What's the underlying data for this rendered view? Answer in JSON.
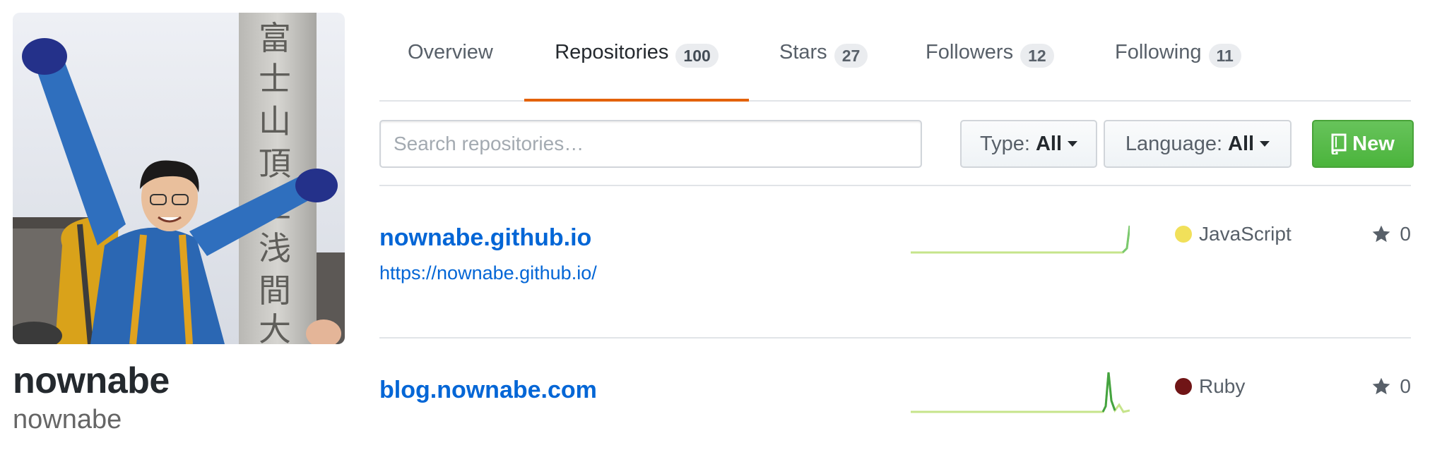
{
  "profile": {
    "fullname": "nownabe",
    "username": "nownabe"
  },
  "tabs": [
    {
      "label": "Overview",
      "count": null,
      "selected": false
    },
    {
      "label": "Repositories",
      "count": "100",
      "selected": true
    },
    {
      "label": "Stars",
      "count": "27",
      "selected": false
    },
    {
      "label": "Followers",
      "count": "12",
      "selected": false
    },
    {
      "label": "Following",
      "count": "11",
      "selected": false
    }
  ],
  "filters": {
    "search_placeholder": "Search repositories…",
    "type_label": "Type:",
    "type_value": "All",
    "language_label": "Language:",
    "language_value": "All",
    "new_label": "New"
  },
  "repos": [
    {
      "name": "nownabe.github.io",
      "description": "https://nownabe.github.io/",
      "language": "JavaScript",
      "language_color": "#f1e05a",
      "stars": "0"
    },
    {
      "name": "blog.nownabe.com",
      "description": "",
      "language": "Ruby",
      "language_color": "#701516",
      "stars": "0"
    }
  ],
  "colors": {
    "accent_tab": "#e36209",
    "link": "#0366d6",
    "new_button": "#4bb43c"
  }
}
